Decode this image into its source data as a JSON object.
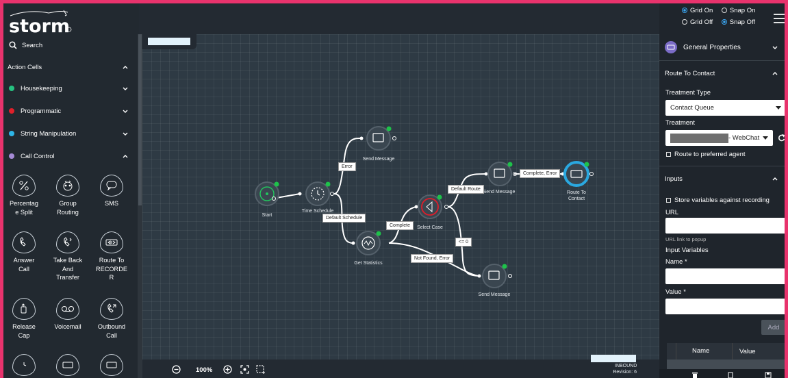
{
  "brand": {
    "logo_text": "storm",
    "accent": "#e8336d"
  },
  "sidebar": {
    "search_label": "Search",
    "action_cells_label": "Action Cells",
    "categories": [
      {
        "label": "Housekeeping",
        "color": "#26c281"
      },
      {
        "label": "Programmatic",
        "color": "#e0202a"
      },
      {
        "label": "String Manipulation",
        "color": "#2eb6e8"
      },
      {
        "label": "Call Control",
        "color": "#a58bd6"
      }
    ],
    "tiles": [
      {
        "label": "Percentag\ne Split",
        "icon": "percent-icon"
      },
      {
        "label": "Group\nRouting",
        "icon": "group-routing-icon"
      },
      {
        "label": "SMS",
        "icon": "sms-icon"
      },
      {
        "label": "Answer\nCall",
        "icon": "answer-call-icon"
      },
      {
        "label": "Take Back\nAnd\nTransfer",
        "icon": "take-back-transfer-icon"
      },
      {
        "label": "Route To\nRECORDE\nR",
        "icon": "route-recorder-icon"
      },
      {
        "label": "Release\nCap",
        "icon": "release-cap-icon"
      },
      {
        "label": "Voicemail",
        "icon": "voicemail-icon"
      },
      {
        "label": "Outbound\nCall",
        "icon": "outbound-call-icon"
      }
    ]
  },
  "canvas": {
    "nodes": [
      {
        "id": "start",
        "label": "Start"
      },
      {
        "id": "time-schedule",
        "label": "Time Schedule"
      },
      {
        "id": "send-message-1",
        "label": "Send Message"
      },
      {
        "id": "get-statistics",
        "label": "Get Statistics"
      },
      {
        "id": "select-case",
        "label": "Select Case"
      },
      {
        "id": "send-message-2",
        "label": "Send Message"
      },
      {
        "id": "route-to-contact",
        "label": "Route To\nContact"
      },
      {
        "id": "send-message-3",
        "label": "Send Message"
      }
    ],
    "edge_labels": [
      "Error",
      "Default Schedule",
      "Complete",
      "Default Route",
      "Complete, Error",
      "<= 0",
      "Not Found, Error"
    ]
  },
  "toolbar": {
    "zoom": "100%",
    "direction": "INBOUND",
    "revision": "Revision: 6"
  },
  "view_options": {
    "grid_on": "Grid On",
    "snap_on": "Snap On",
    "grid_off": "Grid Off",
    "snap_off": "Snap Off",
    "grid_selected": "on",
    "snap_selected": "off"
  },
  "properties": {
    "header": "General Properties",
    "route_section": "Route To Contact",
    "treatment_type_label": "Treatment Type",
    "treatment_type_value": "Contact Queue",
    "treatment_label": "Treatment",
    "treatment_value": "- WebChat",
    "preferred_agent_label": "Route to preferred agent",
    "inputs_section": "Inputs",
    "store_vars_label": "Store variables against recording",
    "url_label": "URL",
    "url_hint": "URL link to popup",
    "input_vars_label": "Input Variables",
    "name_label": "Name *",
    "value_label": "Value *",
    "add_label": "Add",
    "table_headers": [
      "Name",
      "Value"
    ]
  }
}
